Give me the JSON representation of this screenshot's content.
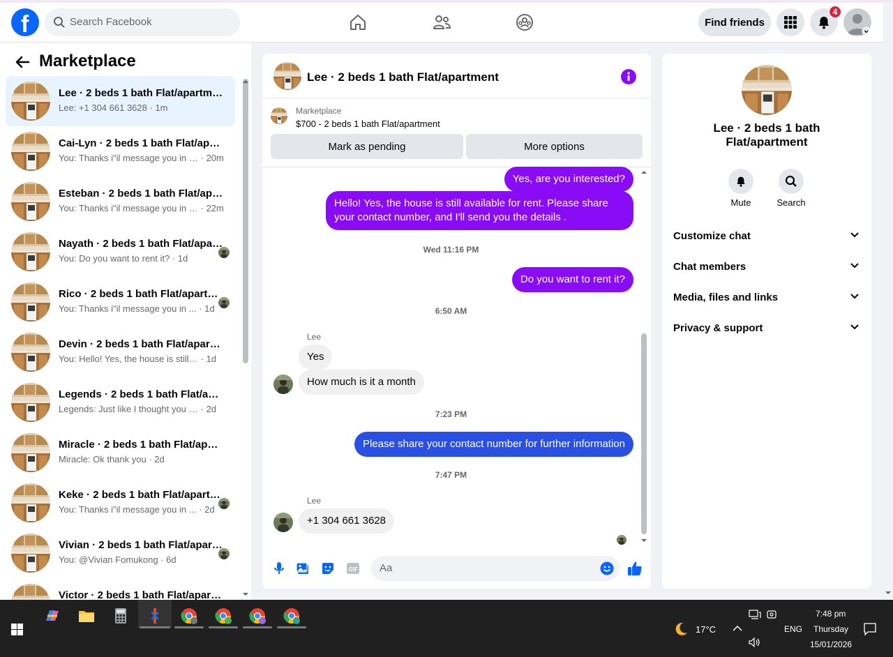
{
  "colors": {
    "brand": "#0866ff",
    "outgoing_bubble": "#8a0bf5",
    "outgoing_bubble_blue": "#2a4fe4",
    "badge": "#e41e3f",
    "active_row": "#e7f3ff"
  },
  "topbar": {
    "search_placeholder": "Search Facebook",
    "nav_icons": [
      "home-icon",
      "friends-icon",
      "groups-icon"
    ],
    "find_friends_label": "Find friends",
    "notification_count": "4"
  },
  "sidebar": {
    "title": "Marketplace",
    "conversations": [
      {
        "name": "Lee · 2 beds 1 bath Flat/apartment",
        "preview": "Lee: +1 304 661 3628",
        "time": "1m",
        "active": true,
        "read_receipt": false
      },
      {
        "name": "Cai-Lyn · 2 beds 1 bath Flat/apartment",
        "preview": "You: Thanks i\"il message you in a...",
        "time": "20m",
        "active": false,
        "read_receipt": false
      },
      {
        "name": "Esteban · 2 beds 1 bath Flat/apartment",
        "preview": "You: Thanks i\"il message you in a...",
        "time": "22m",
        "active": false,
        "read_receipt": false
      },
      {
        "name": "Nayath · 2 beds 1 bath Flat/apartment",
        "preview": "You: Do you want to rent it?",
        "time": "1d",
        "active": false,
        "read_receipt": true
      },
      {
        "name": "Rico · 2 beds 1 bath Flat/apartment",
        "preview": "You: Thanks i\"il message you in ...",
        "time": "1d",
        "active": false,
        "read_receipt": true
      },
      {
        "name": "Devin · 2 beds 1 bath Flat/apartment",
        "preview": "You: Hello! Yes, the house is still av...",
        "time": "1d",
        "active": false,
        "read_receipt": false
      },
      {
        "name": "Legends · 2 beds 1 bath Flat/apartment",
        "preview": "Legends: Just like I thought you are...",
        "time": "2d",
        "active": false,
        "read_receipt": false
      },
      {
        "name": "Miracle · 2 beds 1 bath Flat/apartment",
        "preview": "Miracle: Ok thank you",
        "time": "2d",
        "active": false,
        "read_receipt": false
      },
      {
        "name": "Keke · 2 beds 1 bath Flat/apartment",
        "preview": "You: Thanks i\"il message you in ...",
        "time": "2d",
        "active": false,
        "read_receipt": true
      },
      {
        "name": "Vivian · 2 beds 1 bath Flat/apartment",
        "preview": "You: @Vivian Fomukong",
        "time": "6d",
        "active": false,
        "read_receipt": true
      },
      {
        "name": "Victor · 2 beds 1 bath Flat/apartment",
        "preview": "",
        "time": "",
        "active": false,
        "read_receipt": false
      }
    ]
  },
  "chat": {
    "title": "Lee · 2 beds 1 bath Flat/apartment",
    "listing_label": "Marketplace",
    "listing_price": "$700 - 2 beds 1 bath Flat/apartment",
    "mark_pending_label": "Mark as pending",
    "more_options_label": "More options",
    "messages": {
      "out1": "Yes, are you interested?",
      "out2": "Hello! Yes, the house is still available for rent. Please share your contact number, and I'll send you the details .",
      "ts1": "Wed 11:16 PM",
      "out3": "Do you want to rent it?",
      "ts2": "6:50 AM",
      "sender1": "Lee",
      "in1": "Yes",
      "in2": "How much is it a month",
      "ts3": "7:23 PM",
      "out4": "Please share your contact number for further information",
      "ts4": "7:47 PM",
      "sender2": "Lee",
      "in3": "+1 304 661 3628"
    },
    "composer_placeholder": "Aa"
  },
  "details": {
    "name": "Lee · 2 beds 1 bath Flat/apartment",
    "mute_label": "Mute",
    "search_label": "Search",
    "rows": [
      "Customize chat",
      "Chat members",
      "Media, files and links",
      "Privacy & support"
    ]
  },
  "taskbar": {
    "temperature": "17°C",
    "language": "ENG",
    "time": "7:48 pm",
    "day": "Thursday",
    "date": "15/01/2026"
  }
}
